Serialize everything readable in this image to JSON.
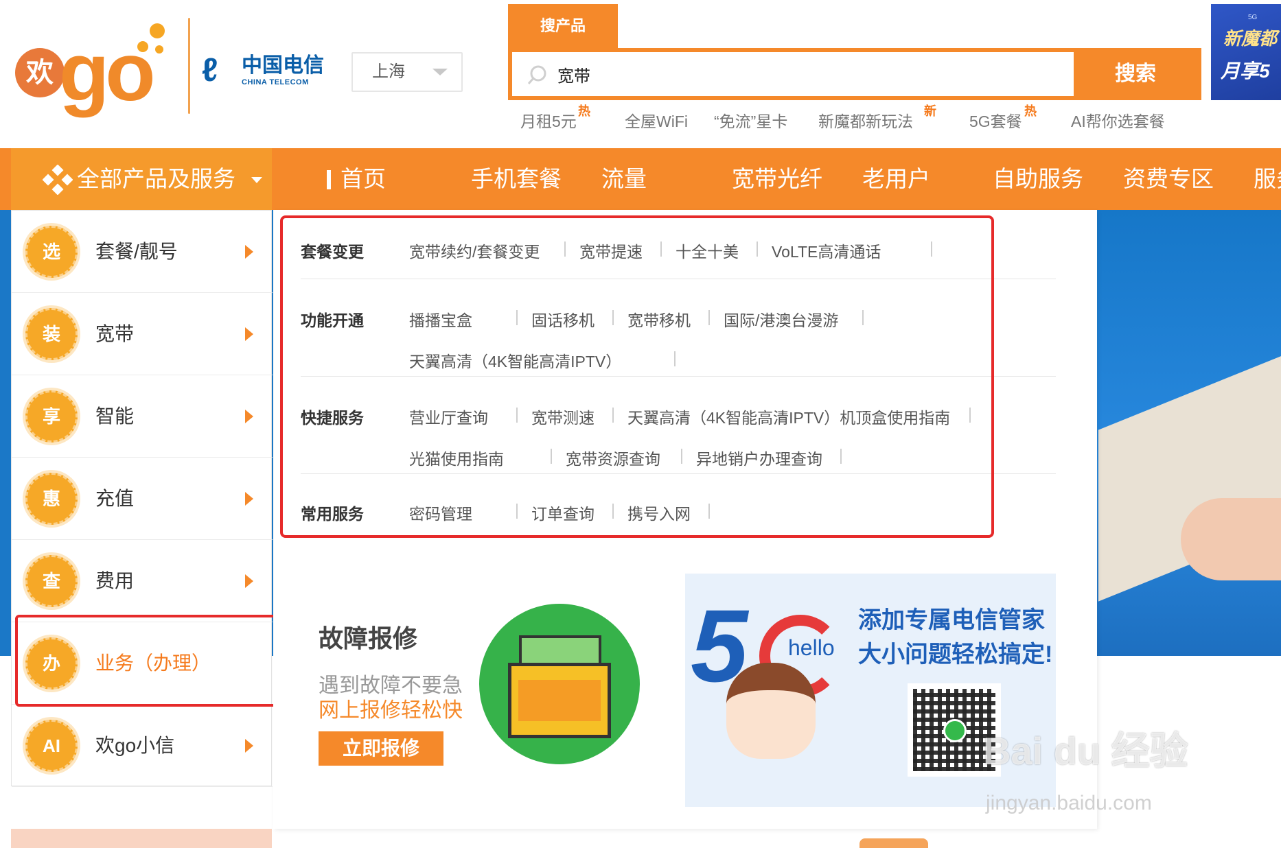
{
  "header": {
    "logo_text": "欢go",
    "logo_circle": "欢",
    "carrier_cn": "中国电信",
    "carrier_en": "CHINA TELECOM",
    "city": "上海",
    "search_tab": "搜产品",
    "search_value": "宽带",
    "search_button": "搜索",
    "hot_links": [
      "月租5元",
      "全屋WiFi",
      "“免流”星卡",
      "新魔都新玩法",
      "5G套餐",
      "AI帮你选套餐"
    ],
    "hot_badges": {
      "hot": "热",
      "new": "新"
    },
    "promo_corner": {
      "line1": "新魔都",
      "line2": "月享5",
      "tag": "5G"
    }
  },
  "nav": {
    "all_products": "全部产品及服务",
    "items": [
      "首页",
      "手机套餐",
      "流量",
      "宽带光纤",
      "老用户",
      "自助服务",
      "资费专区",
      "服务"
    ]
  },
  "left_menu": [
    {
      "badge": "选",
      "label": "套餐/靓号"
    },
    {
      "badge": "装",
      "label": "宽带"
    },
    {
      "badge": "享",
      "label": "智能"
    },
    {
      "badge": "惠",
      "label": "充值"
    },
    {
      "badge": "查",
      "label": "费用"
    },
    {
      "badge": "办",
      "label": "业务（办理）",
      "active": true
    },
    {
      "badge": "AI",
      "label": "欢go小信"
    }
  ],
  "dropdown": {
    "sections": [
      {
        "title": "套餐变更",
        "rows": [
          [
            "宽带续约/套餐变更",
            "宽带提速",
            "十全十美",
            "VoLTE高清通话"
          ]
        ]
      },
      {
        "title": "功能开通",
        "rows": [
          [
            "播播宝盒",
            "固话移机",
            "宽带移机",
            "国际/港澳台漫游"
          ],
          [
            "天翼高清（4K智能高清IPTV）"
          ]
        ]
      },
      {
        "title": "快捷服务",
        "rows": [
          [
            "营业厅查询",
            "宽带测速",
            "天翼高清（4K智能高清IPTV）机顶盒使用指南"
          ],
          [
            "光猫使用指南",
            "宽带资源查询",
            "异地销户办理查询"
          ]
        ]
      },
      {
        "title": "常用服务",
        "rows": [
          [
            "密码管理",
            "订单查询",
            "携号入网"
          ]
        ]
      }
    ],
    "repair": {
      "title": "故障报修",
      "line1": "遇到故障不要急",
      "line2": "网上报修轻松快",
      "button": "立即报修"
    },
    "helper": {
      "hello": "hello",
      "line1": "添加专属电信管家",
      "line2": "大小问题轻松搞定!"
    }
  },
  "watermark": {
    "main": "Bai du 经验",
    "sub": "jingyan.baidu.com"
  },
  "colors": {
    "brand_orange": "#f5892a",
    "highlight_red": "#e62a2a",
    "telecom_blue": "#0a5ea8"
  }
}
